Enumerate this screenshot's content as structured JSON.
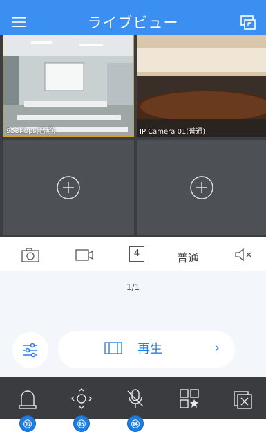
{
  "header": {
    "title": "ライブビュー",
    "menu_icon": "menu-icon",
    "switch_icon": "window-switch-icon",
    "bg_color": "#3b8ff0"
  },
  "cameras": [
    {
      "label": "953Kbps(普通)"
    },
    {
      "label": "IP Camera 01(普通)"
    }
  ],
  "toolbar": {
    "snapshot_icon": "camera-icon",
    "record_icon": "video-record-icon",
    "layout_count": "4",
    "quality": "普通",
    "mute_icon": "speaker-mute-icon"
  },
  "pager": {
    "text": "1/1"
  },
  "playback": {
    "label": "再生",
    "icon": "film-icon"
  },
  "bottom_bar": {
    "items": [
      "alarm-light-icon",
      "ptz-control-icon",
      "mic-off-icon",
      "favorites-icon",
      "close-all-icon"
    ]
  },
  "badges": [
    "⑯",
    "⑮",
    "⑭"
  ],
  "accent_color": "#1e7ee0"
}
